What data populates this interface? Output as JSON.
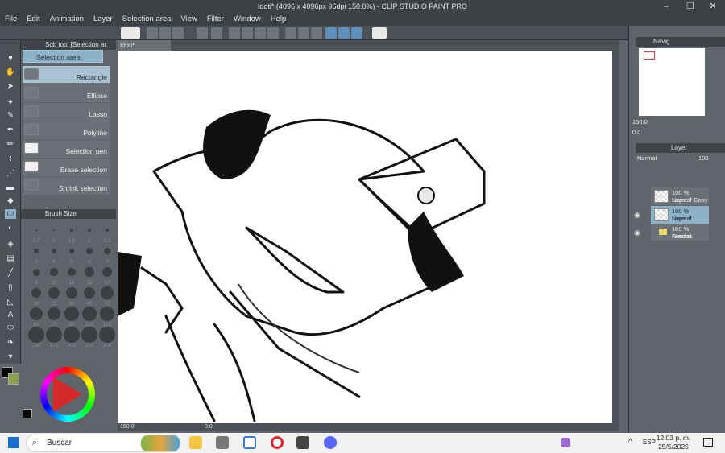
{
  "app": {
    "title": "Idoti* (4096 x 4096px 96dpi 150.0%)  - CLIP STUDIO PAINT PRO",
    "menu": [
      "File",
      "Edit",
      "Animation",
      "Layer",
      "Selection area",
      "View",
      "Filter",
      "Window",
      "Help"
    ]
  },
  "subtool": {
    "header": "Sub tool [Selection ar",
    "group": "Selection area",
    "items": [
      "Rectangle",
      "Ellipse",
      "Lasso",
      "Polyline",
      "Selection pen",
      "Erase selection",
      "Shrink selection"
    ]
  },
  "brush": {
    "header": "Brush Size",
    "sizes": [
      "0.7",
      "1",
      "1.5",
      "2",
      "2.5",
      "3",
      "4",
      "5",
      "6",
      "7",
      "8",
      "10",
      "12",
      "15",
      "17",
      "20",
      "25",
      "30",
      "40",
      "50",
      "60",
      "70",
      "80",
      "100",
      "120",
      "150",
      "170",
      "200",
      "250",
      "300"
    ]
  },
  "canvas": {
    "tab": "Idoti*",
    "zoom": "150.0",
    "rotation": "0.0"
  },
  "navigator": {
    "tab": "Navig",
    "zoom": "150.0",
    "angle": "0.0"
  },
  "layers": {
    "tab": "Layer",
    "blend_mode": "Normal",
    "opacity": "100",
    "items": [
      {
        "mode": "100 % Normal",
        "name": "Layer 7 Copy"
      },
      {
        "mode": "100 % Normal",
        "name": "Layer 7"
      },
      {
        "mode": "100 % Normal",
        "name": "Fondos"
      }
    ]
  },
  "taskbar": {
    "search_placeholder": "Buscar",
    "language": "ESP",
    "time": "12:03 p. m.",
    "date": "25/5/2025"
  },
  "colors": {
    "main": "#000000",
    "sub": "#8ba04a",
    "accent": "#8db1c7"
  }
}
